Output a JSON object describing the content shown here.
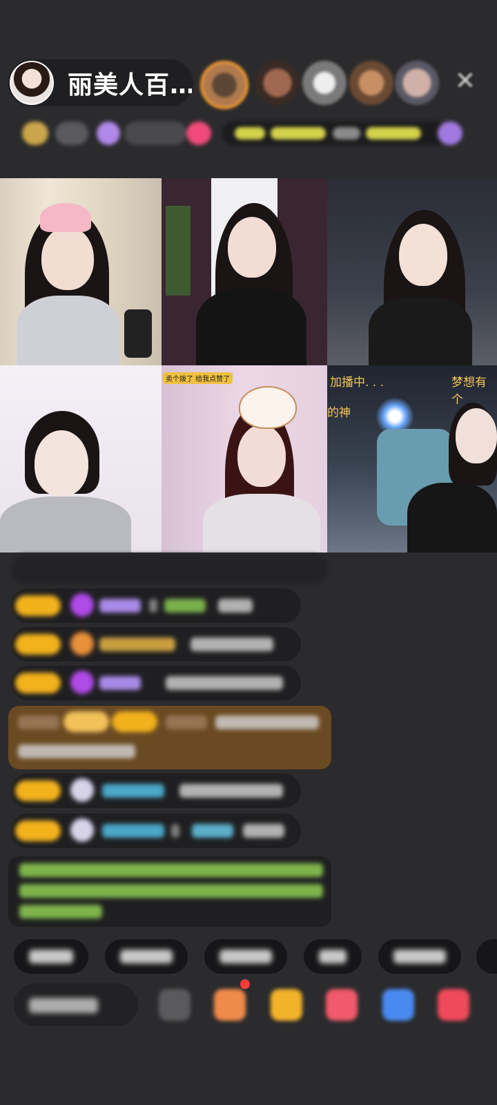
{
  "header": {
    "host_name": "丽美人百…",
    "close_icon": "close-icon"
  },
  "video_grid": {
    "cells": [
      {
        "id": 1,
        "overlay_text": ""
      },
      {
        "id": 2,
        "overlay_text": ""
      },
      {
        "id": 3,
        "overlay_text": ""
      },
      {
        "id": 4,
        "overlay_text": ""
      },
      {
        "id": 5,
        "overlay_text": "卖个拨了 给我点赞了"
      },
      {
        "id": 6,
        "overlay_text_left": "加播中. . .",
        "overlay_text_right": "梦想有个",
        "overlay_text_mid": "的神"
      }
    ]
  },
  "colors": {
    "background": "#2b2b2d",
    "level_badge": "#f2b21c",
    "gift_card": "#6a4a22",
    "green_text": "#8fcf52",
    "notify_dot": "#ff3b3b"
  }
}
